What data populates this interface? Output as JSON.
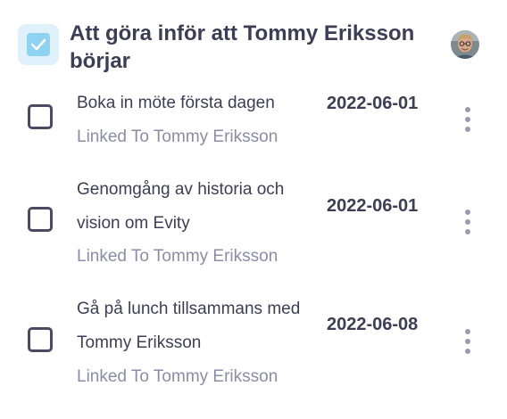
{
  "header": {
    "title": "Att göra inför att Tommy Eriksson börjar",
    "checkbox_checked": true,
    "icon": "check-square-icon",
    "avatar": "user-avatar"
  },
  "tasks": [
    {
      "title": "Boka in möte första dagen",
      "linked": "Linked To Tommy Eriksson",
      "date": "2022-06-01",
      "checked": false
    },
    {
      "title": "Genomgång av historia och vision om Evity",
      "linked": "Linked To Tommy Eriksson",
      "date": "2022-06-01",
      "checked": false
    },
    {
      "title": "Gå på lunch tillsammans med Tommy Eriksson",
      "linked": "Linked To Tommy Eriksson",
      "date": "2022-06-08",
      "checked": false
    }
  ],
  "colors": {
    "text": "#3f3d56",
    "muted": "#8e8ba8",
    "accent_bg": "#dff1fb",
    "accent": "#8fd3f3",
    "dots": "#9b9bb0"
  }
}
